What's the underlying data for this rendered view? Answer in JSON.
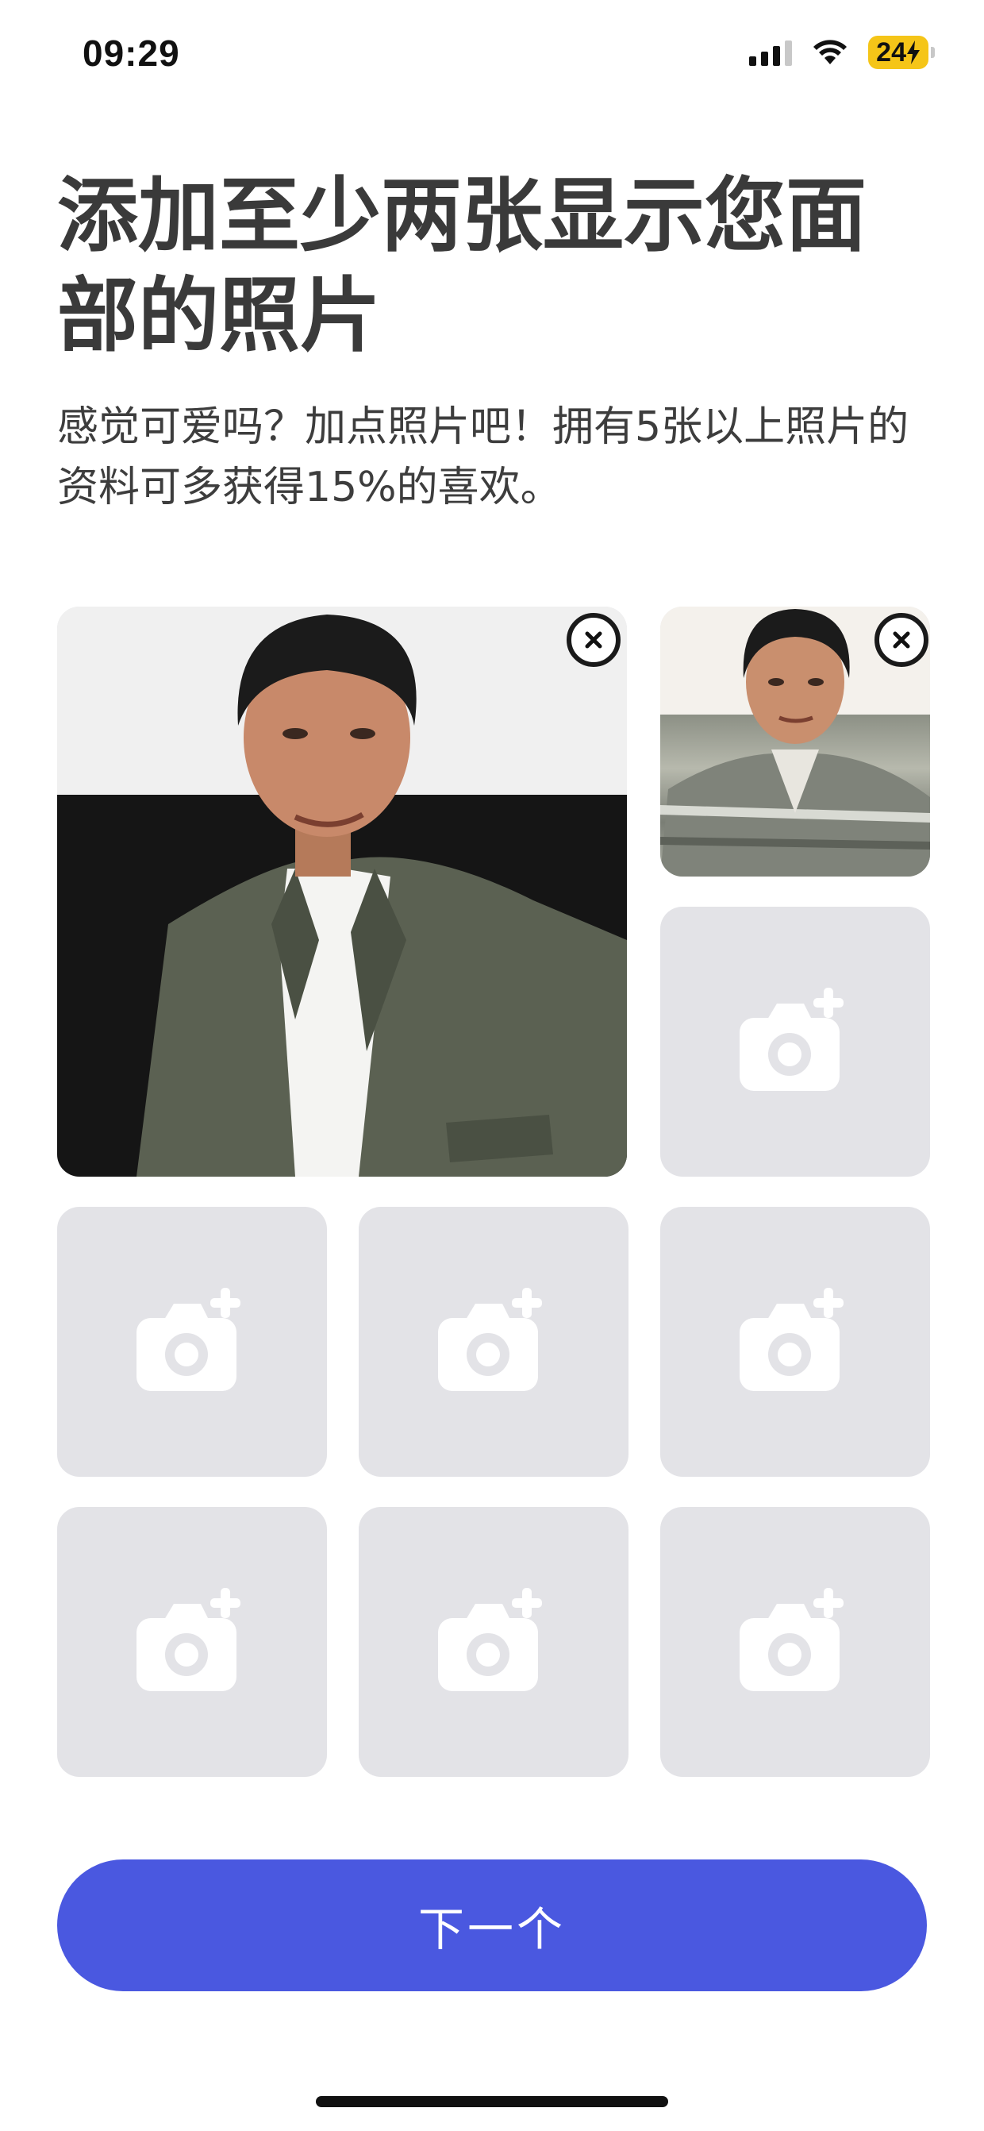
{
  "status_bar": {
    "time": "09:29",
    "battery": "24"
  },
  "title": "添加至少两张显示您面部的照片",
  "subtitle": "感觉可爱吗？加点照片吧！拥有5张以上照片的资料可多获得15%的喜欢。",
  "photos": {
    "count_filled": 2,
    "slots_total": 9
  },
  "next_button": {
    "label": "下一个"
  },
  "colors": {
    "accent": "#4a58e0",
    "slot_bg": "#e3e3e7",
    "text": "#3a3a3a"
  },
  "icons": {
    "remove": "close-icon",
    "add_photo": "camera-plus-icon"
  }
}
